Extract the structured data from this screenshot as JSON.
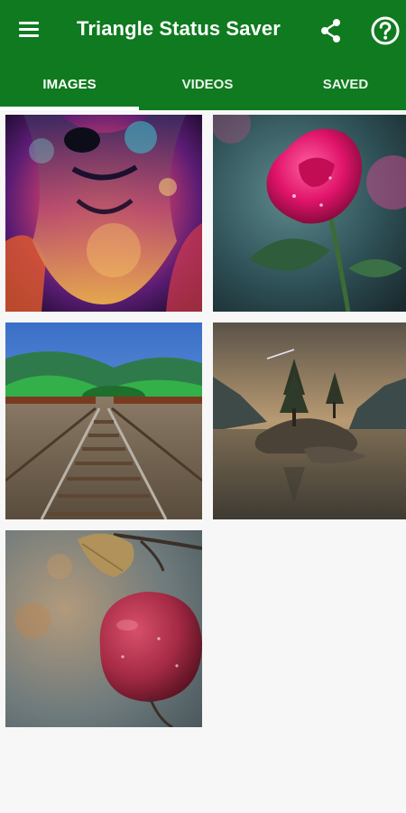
{
  "app": {
    "title": "Triangle Status Saver",
    "accent_color": "#0f7a1f"
  },
  "toolbar": {
    "menu_icon": "hamburger-menu-icon",
    "share_icon": "share-icon",
    "help_icon": "help-circle-icon"
  },
  "tabs": [
    {
      "label": "IMAGES",
      "selected": true
    },
    {
      "label": "VIDEOS",
      "selected": false
    },
    {
      "label": "SAVED",
      "selected": false
    }
  ],
  "images": [
    {
      "subject": "lion"
    },
    {
      "subject": "rose"
    },
    {
      "subject": "railway-track"
    },
    {
      "subject": "lake-island"
    },
    {
      "subject": "apple"
    }
  ]
}
